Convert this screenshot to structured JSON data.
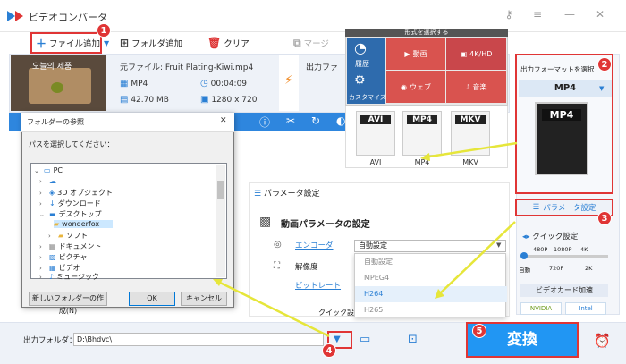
{
  "app": {
    "title": "ビデオコンバータ"
  },
  "toolbar": {
    "add_file": "ファイル追加",
    "add_folder": "フォルダ追加",
    "clear": "クリア",
    "merge": "マージ"
  },
  "source": {
    "label": "元ファイル: Fruit Plating-Kiwi.mp4",
    "format": "MP4",
    "duration": "00:04:09",
    "size": "42.70 MB",
    "resolution": "1280 x 720",
    "thumb_text": "오늘의 제품"
  },
  "output_label": "出力ファ",
  "folder_dialog": {
    "title": "フォルダーの参照",
    "prompt": "パスを選択してください：",
    "tree": [
      "PC",
      "",
      "3D オブジェクト",
      "ダウンロード",
      "デスクトップ",
      "wonderfox",
      "ソフト",
      "ドキュメント",
      "ピクチャ",
      "ビデオ",
      "ミュージック"
    ],
    "new_folder": "新しいフォルダーの作成(N)",
    "ok": "OK",
    "cancel": "キャンセル"
  },
  "format_panel": {
    "header": "形式を選択する",
    "history": "履歴",
    "customize": "カスタマイズ",
    "video": "動画",
    "hd": "4K/HD",
    "web": "ウェブ",
    "music": "音楽",
    "cards": [
      "AVI",
      "MP4",
      "MKV"
    ]
  },
  "right_panel": {
    "output_format_title": "出力フォーマットを選択",
    "selected_format": "MP4",
    "param_button": "パラメータ設定",
    "quick_title": "クイック設定",
    "quick_labels_top": [
      "480P",
      "1080P",
      "4K"
    ],
    "quick_labels_bottom": [
      "自動",
      "720P",
      "2K"
    ],
    "gpu_title": "ビデオカード加速",
    "nvidia": "NVIDIA",
    "intel": "Intel"
  },
  "params": {
    "section_title": "パラメータ設定",
    "video_title": "動画パラメータの設定",
    "encoder_label": "エンコーダ",
    "encoder_value": "自動設定",
    "resolution_label": "解像度",
    "bitrate_label": "ビットレート",
    "quick_label": "クイック設定",
    "dropdown": [
      "自動設定",
      "MPEG4",
      "H264",
      "H265"
    ]
  },
  "bottom": {
    "output_folder_label": "出力フォルダ：",
    "output_path": "D:\\Bhdvc\\",
    "convert": "変換"
  },
  "badges": [
    "1",
    "2",
    "3",
    "4",
    "5"
  ]
}
